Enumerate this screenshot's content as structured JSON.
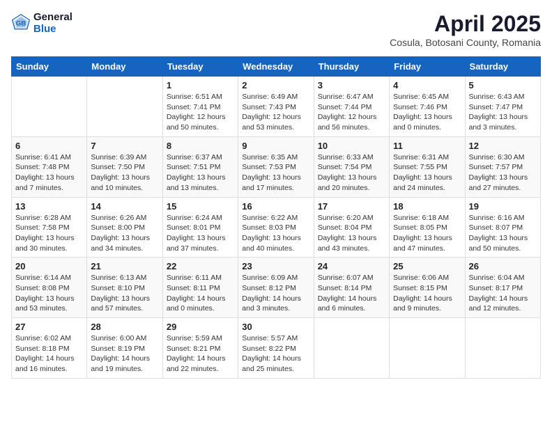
{
  "header": {
    "logo_general": "General",
    "logo_blue": "Blue",
    "month_year": "April 2025",
    "location": "Cosula, Botosani County, Romania"
  },
  "days_of_week": [
    "Sunday",
    "Monday",
    "Tuesday",
    "Wednesday",
    "Thursday",
    "Friday",
    "Saturday"
  ],
  "weeks": [
    [
      {
        "day": "",
        "sunrise": "",
        "sunset": "",
        "daylight": ""
      },
      {
        "day": "",
        "sunrise": "",
        "sunset": "",
        "daylight": ""
      },
      {
        "day": "1",
        "sunrise": "Sunrise: 6:51 AM",
        "sunset": "Sunset: 7:41 PM",
        "daylight": "Daylight: 12 hours and 50 minutes."
      },
      {
        "day": "2",
        "sunrise": "Sunrise: 6:49 AM",
        "sunset": "Sunset: 7:43 PM",
        "daylight": "Daylight: 12 hours and 53 minutes."
      },
      {
        "day": "3",
        "sunrise": "Sunrise: 6:47 AM",
        "sunset": "Sunset: 7:44 PM",
        "daylight": "Daylight: 12 hours and 56 minutes."
      },
      {
        "day": "4",
        "sunrise": "Sunrise: 6:45 AM",
        "sunset": "Sunset: 7:46 PM",
        "daylight": "Daylight: 13 hours and 0 minutes."
      },
      {
        "day": "5",
        "sunrise": "Sunrise: 6:43 AM",
        "sunset": "Sunset: 7:47 PM",
        "daylight": "Daylight: 13 hours and 3 minutes."
      }
    ],
    [
      {
        "day": "6",
        "sunrise": "Sunrise: 6:41 AM",
        "sunset": "Sunset: 7:48 PM",
        "daylight": "Daylight: 13 hours and 7 minutes."
      },
      {
        "day": "7",
        "sunrise": "Sunrise: 6:39 AM",
        "sunset": "Sunset: 7:50 PM",
        "daylight": "Daylight: 13 hours and 10 minutes."
      },
      {
        "day": "8",
        "sunrise": "Sunrise: 6:37 AM",
        "sunset": "Sunset: 7:51 PM",
        "daylight": "Daylight: 13 hours and 13 minutes."
      },
      {
        "day": "9",
        "sunrise": "Sunrise: 6:35 AM",
        "sunset": "Sunset: 7:53 PM",
        "daylight": "Daylight: 13 hours and 17 minutes."
      },
      {
        "day": "10",
        "sunrise": "Sunrise: 6:33 AM",
        "sunset": "Sunset: 7:54 PM",
        "daylight": "Daylight: 13 hours and 20 minutes."
      },
      {
        "day": "11",
        "sunrise": "Sunrise: 6:31 AM",
        "sunset": "Sunset: 7:55 PM",
        "daylight": "Daylight: 13 hours and 24 minutes."
      },
      {
        "day": "12",
        "sunrise": "Sunrise: 6:30 AM",
        "sunset": "Sunset: 7:57 PM",
        "daylight": "Daylight: 13 hours and 27 minutes."
      }
    ],
    [
      {
        "day": "13",
        "sunrise": "Sunrise: 6:28 AM",
        "sunset": "Sunset: 7:58 PM",
        "daylight": "Daylight: 13 hours and 30 minutes."
      },
      {
        "day": "14",
        "sunrise": "Sunrise: 6:26 AM",
        "sunset": "Sunset: 8:00 PM",
        "daylight": "Daylight: 13 hours and 34 minutes."
      },
      {
        "day": "15",
        "sunrise": "Sunrise: 6:24 AM",
        "sunset": "Sunset: 8:01 PM",
        "daylight": "Daylight: 13 hours and 37 minutes."
      },
      {
        "day": "16",
        "sunrise": "Sunrise: 6:22 AM",
        "sunset": "Sunset: 8:03 PM",
        "daylight": "Daylight: 13 hours and 40 minutes."
      },
      {
        "day": "17",
        "sunrise": "Sunrise: 6:20 AM",
        "sunset": "Sunset: 8:04 PM",
        "daylight": "Daylight: 13 hours and 43 minutes."
      },
      {
        "day": "18",
        "sunrise": "Sunrise: 6:18 AM",
        "sunset": "Sunset: 8:05 PM",
        "daylight": "Daylight: 13 hours and 47 minutes."
      },
      {
        "day": "19",
        "sunrise": "Sunrise: 6:16 AM",
        "sunset": "Sunset: 8:07 PM",
        "daylight": "Daylight: 13 hours and 50 minutes."
      }
    ],
    [
      {
        "day": "20",
        "sunrise": "Sunrise: 6:14 AM",
        "sunset": "Sunset: 8:08 PM",
        "daylight": "Daylight: 13 hours and 53 minutes."
      },
      {
        "day": "21",
        "sunrise": "Sunrise: 6:13 AM",
        "sunset": "Sunset: 8:10 PM",
        "daylight": "Daylight: 13 hours and 57 minutes."
      },
      {
        "day": "22",
        "sunrise": "Sunrise: 6:11 AM",
        "sunset": "Sunset: 8:11 PM",
        "daylight": "Daylight: 14 hours and 0 minutes."
      },
      {
        "day": "23",
        "sunrise": "Sunrise: 6:09 AM",
        "sunset": "Sunset: 8:12 PM",
        "daylight": "Daylight: 14 hours and 3 minutes."
      },
      {
        "day": "24",
        "sunrise": "Sunrise: 6:07 AM",
        "sunset": "Sunset: 8:14 PM",
        "daylight": "Daylight: 14 hours and 6 minutes."
      },
      {
        "day": "25",
        "sunrise": "Sunrise: 6:06 AM",
        "sunset": "Sunset: 8:15 PM",
        "daylight": "Daylight: 14 hours and 9 minutes."
      },
      {
        "day": "26",
        "sunrise": "Sunrise: 6:04 AM",
        "sunset": "Sunset: 8:17 PM",
        "daylight": "Daylight: 14 hours and 12 minutes."
      }
    ],
    [
      {
        "day": "27",
        "sunrise": "Sunrise: 6:02 AM",
        "sunset": "Sunset: 8:18 PM",
        "daylight": "Daylight: 14 hours and 16 minutes."
      },
      {
        "day": "28",
        "sunrise": "Sunrise: 6:00 AM",
        "sunset": "Sunset: 8:19 PM",
        "daylight": "Daylight: 14 hours and 19 minutes."
      },
      {
        "day": "29",
        "sunrise": "Sunrise: 5:59 AM",
        "sunset": "Sunset: 8:21 PM",
        "daylight": "Daylight: 14 hours and 22 minutes."
      },
      {
        "day": "30",
        "sunrise": "Sunrise: 5:57 AM",
        "sunset": "Sunset: 8:22 PM",
        "daylight": "Daylight: 14 hours and 25 minutes."
      },
      {
        "day": "",
        "sunrise": "",
        "sunset": "",
        "daylight": ""
      },
      {
        "day": "",
        "sunrise": "",
        "sunset": "",
        "daylight": ""
      },
      {
        "day": "",
        "sunrise": "",
        "sunset": "",
        "daylight": ""
      }
    ]
  ]
}
